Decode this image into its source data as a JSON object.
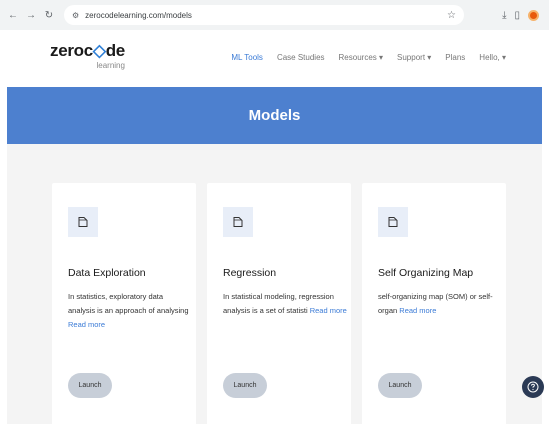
{
  "browser": {
    "url": "zerocodelearning.com/models"
  },
  "site": {
    "logo": {
      "main_before": "zeroc",
      "main_after": "de",
      "sub": "learning"
    },
    "nav": {
      "ml_tools": "ML Tools",
      "case_studies": "Case Studies",
      "resources": "Resources ▾",
      "support": "Support ▾",
      "plans": "Plans",
      "hello": "Hello, ▾"
    },
    "banner_title": "Models",
    "cards": [
      {
        "title": "Data Exploration",
        "description": "In statistics, exploratory data analysis is an approach of analysing",
        "read_more": "Read more",
        "launch": "Launch"
      },
      {
        "title": "Regression",
        "description": "In statistical modeling, regression analysis is a set of statisti",
        "read_more": "Read more",
        "launch": "Launch"
      },
      {
        "title": "Self Organizing Map",
        "description": "self-organizing map (SOM) or self-organ",
        "read_more": "Read more",
        "launch": "Launch"
      }
    ]
  },
  "colors": {
    "banner": "#4d80cf",
    "link": "#3b7bd6",
    "help_button": "#2b3a55"
  },
  "icons": {
    "card_icon": "file-icon",
    "help": "help-icon"
  }
}
